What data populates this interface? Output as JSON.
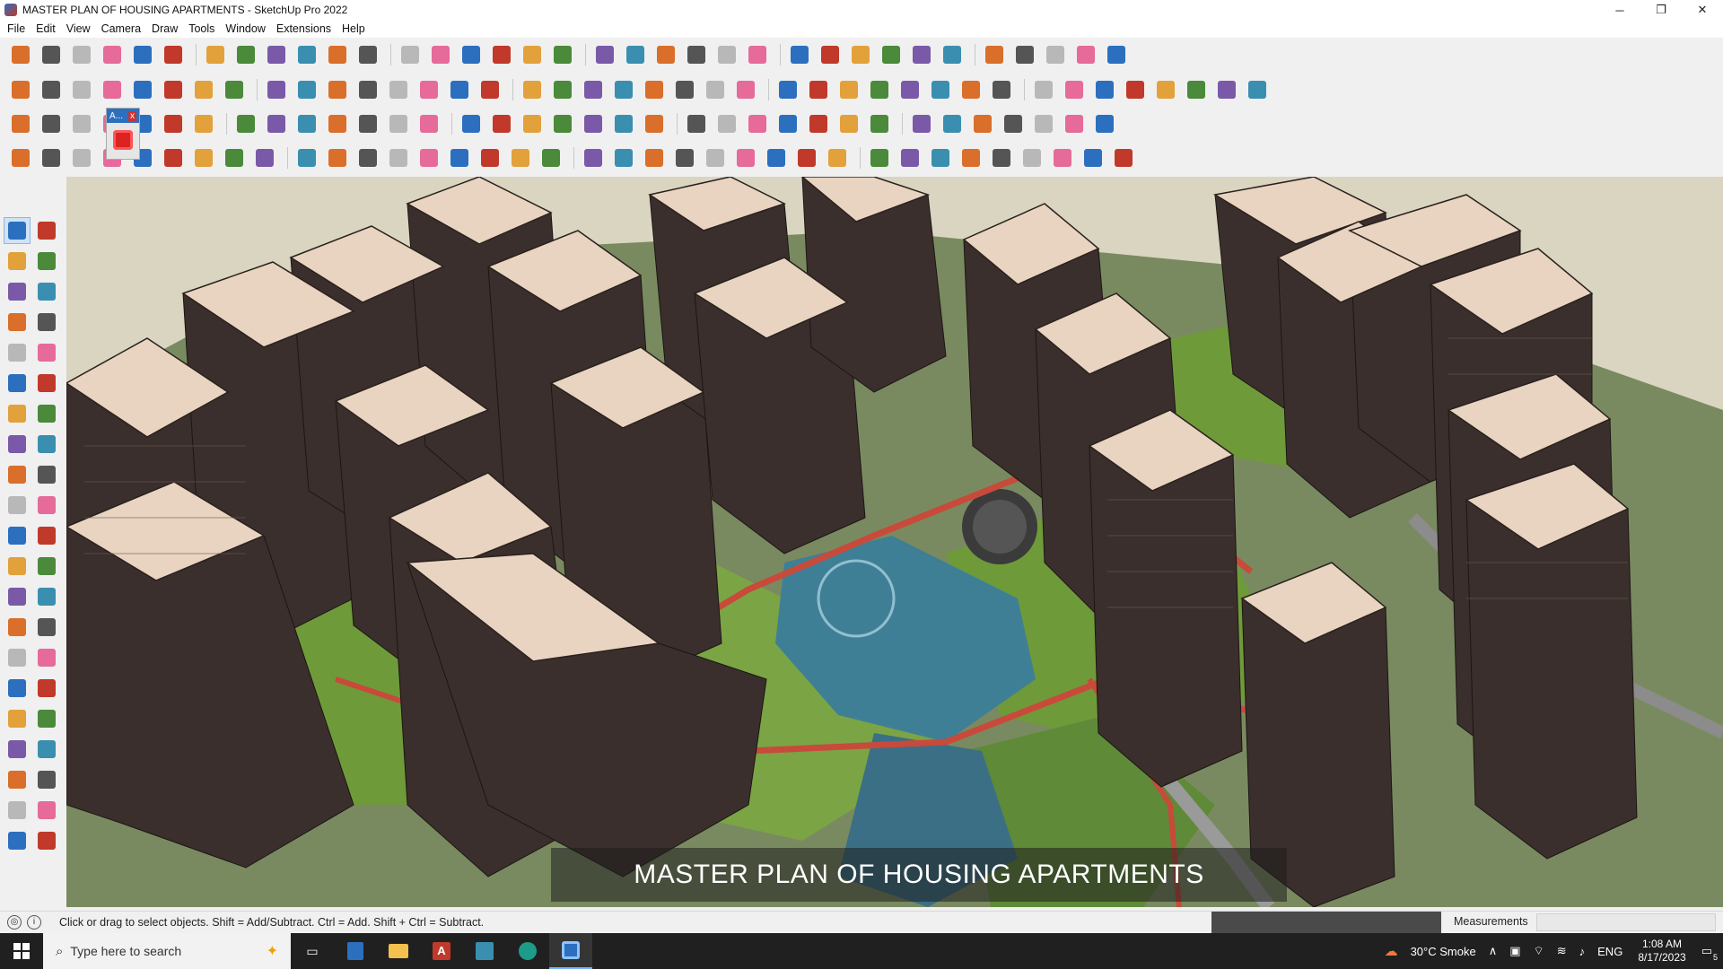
{
  "window": {
    "title": "MASTER PLAN OF HOUSING APARTMENTS - SketchUp Pro 2022",
    "minimize": "─",
    "restore": "❐",
    "close": "✕"
  },
  "menu": [
    "File",
    "Edit",
    "View",
    "Camera",
    "Draw",
    "Tools",
    "Window",
    "Extensions",
    "Help"
  ],
  "toolbar": {
    "row1": [
      "zoom-extents",
      "select",
      "eraser",
      "line",
      "arc",
      "rectangle",
      "push-pull",
      "follow-me",
      "move",
      "rotate",
      "scale",
      "tape-measure",
      "text",
      "paint-bucket",
      "orbit",
      "pan",
      "zoom",
      "zoom-window",
      "section-plane",
      "layer",
      "outliner",
      "components",
      "styles",
      "warehouse",
      "extension-warehouse",
      "send-to-layout",
      "sandbox-a",
      "sandbox-b",
      "sandbox-c",
      "solid-tools",
      "move-up",
      "move-down",
      "undo",
      "redo",
      "help"
    ],
    "row2": [
      "iso-view",
      "top-view",
      "front-view",
      "right-view",
      "back-view",
      "left-view",
      "bottom-view",
      "x-ray",
      "back-edges",
      "wireframe",
      "hidden-line",
      "shaded",
      "textured",
      "monochrome",
      "house-a",
      "house-b",
      "house-c",
      "house-d",
      "house-e",
      "fx",
      "leaf",
      "pencil",
      "curve-a",
      "curve-b",
      "curve-c",
      "curve-d",
      "curve-e",
      "curve-f",
      "curve-g",
      "curve-h",
      "curve-i",
      "curve-j",
      "curve-k",
      "plugin-a",
      "plugin-b",
      "plugin-c",
      "plugin-d",
      "plugin-e",
      "plugin-f",
      "plugin-g"
    ],
    "row3": [
      "layer-blue",
      "layer-cyan",
      "layer-yellow",
      "layer-red",
      "stair",
      "hook",
      "box-red",
      "list",
      "door",
      "stairs-b",
      "arc-tool",
      "dotted-line",
      "cross-red",
      "cross-green",
      "cross-blue",
      "cone",
      "flame",
      "triangle",
      "loop",
      "knot",
      "spiral",
      "snowflake",
      "cup",
      "magnet",
      "tree",
      "box-a",
      "box-b",
      "gem",
      "grid-a",
      "grid-b",
      "grid-c",
      "grid-d",
      "scatter",
      "curve",
      "grid-e"
    ],
    "row4": [
      "select-line",
      "bezier",
      "3d-text",
      "polyline",
      "arc-b",
      "sweep",
      "loft",
      "mesh",
      "shell",
      "axis",
      "corner",
      "corner-b",
      "slash",
      "curve-b",
      "frame",
      "fan",
      "mesh-a",
      "mesh-b",
      "mesh-c",
      "mesh-d",
      "fold",
      "fold-b",
      "fold-c",
      "grid-f",
      "grid-g",
      "grid-h",
      "grid-i",
      "grid-j",
      "grid-k",
      "grid-l",
      "grid-m",
      "grid-n",
      "grid-o",
      "grid-p",
      "grid-q",
      "grid-r"
    ]
  },
  "floating_panel": {
    "label": "A...",
    "close": "x"
  },
  "palette": [
    [
      "select-arrow",
      "orbit-hand"
    ],
    [
      "paint-bucket",
      "eraser"
    ],
    [
      "component",
      "tape"
    ],
    [
      "line-pen",
      "freehand"
    ],
    [
      "rectangle",
      "rotated-rect"
    ],
    [
      "circle",
      "polygon"
    ],
    [
      "arc",
      "arc-2"
    ],
    [
      "arc-3",
      "pie"
    ],
    [
      "move",
      "push-pull"
    ],
    [
      "rotate",
      "follow-me"
    ],
    [
      "scale",
      "offset"
    ],
    [
      "tape-measure",
      "dimension"
    ],
    [
      "protractor",
      "text"
    ],
    [
      "axes",
      "3d-text"
    ],
    [
      "orbit",
      "pan"
    ],
    [
      "zoom",
      "zoom-window"
    ],
    [
      "zoom-extents",
      "previous"
    ],
    [
      "position-camera",
      "look-around"
    ],
    [
      "walk",
      "section"
    ],
    [
      "sandbox-a",
      "sandbox-b"
    ],
    [
      "sandbox-c",
      "sandbox-d"
    ]
  ],
  "caption": "MASTER PLAN OF HOUSING APARTMENTS",
  "status": {
    "hint": "Click or drag to select objects. Shift = Add/Subtract. Ctrl = Add. Shift + Ctrl = Subtract.",
    "measurements_label": "Measurements"
  },
  "taskbar": {
    "search_placeholder": "Type here to search",
    "weather": "30°C  Smoke",
    "lang": "ENG",
    "time": "1:08 AM",
    "date": "8/17/2023",
    "notif_count": "5"
  },
  "colors": {
    "accent": "#2c6fbf",
    "grass": "#6f9a3a",
    "water": "#3f7f96",
    "path_red": "#c84a3a",
    "roof": "#e8d4c0",
    "building_dark": "#3a2f2c"
  }
}
